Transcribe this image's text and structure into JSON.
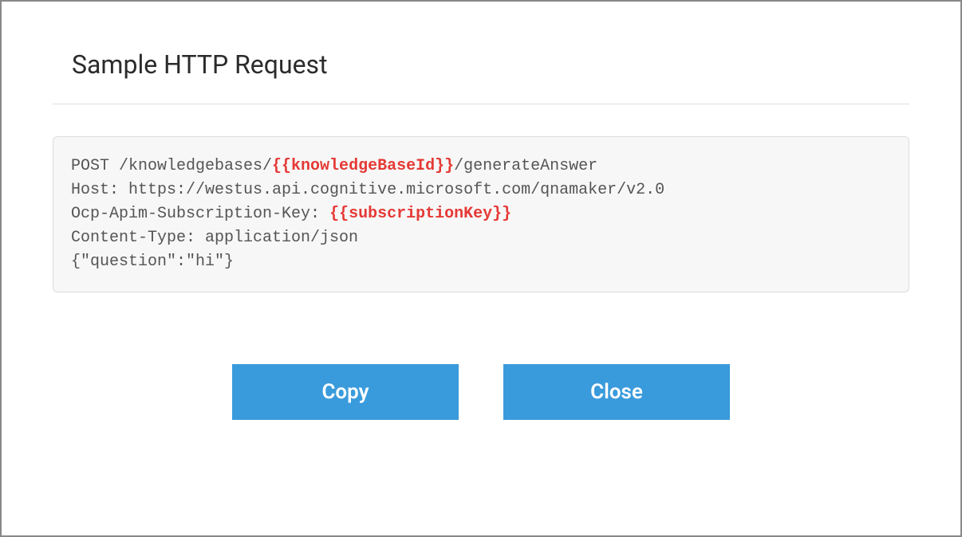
{
  "title": "Sample HTTP Request",
  "code": {
    "line1_prefix": "POST /knowledgebases/",
    "line1_placeholder": "{{knowledgeBaseId}}",
    "line1_suffix": "/generateAnswer",
    "line2": "Host: https://westus.api.cognitive.microsoft.com/qnamaker/v2.0",
    "line3_prefix": "Ocp-Apim-Subscription-Key: ",
    "line3_placeholder": "{{subscriptionKey}}",
    "line4": "Content-Type: application/json",
    "line5": "{\"question\":\"hi\"}"
  },
  "buttons": {
    "copy": "Copy",
    "close": "Close"
  }
}
